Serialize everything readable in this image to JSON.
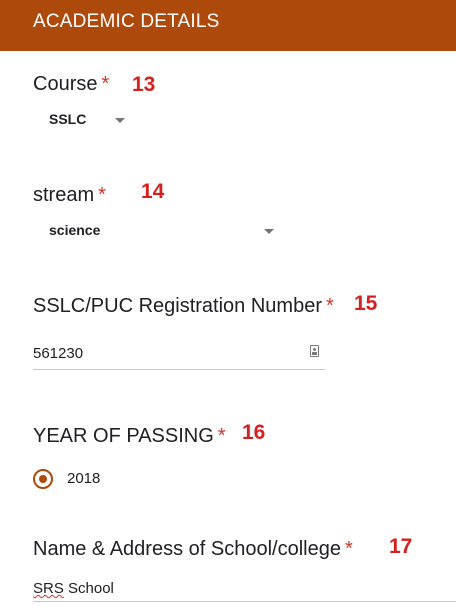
{
  "header": {
    "title": "ACADEMIC DETAILS",
    "background_color": "#ad4a0b"
  },
  "required_marker": "*",
  "questions": {
    "course": {
      "title": "Course",
      "number": "13",
      "selected": "SSLC"
    },
    "stream": {
      "title": "stream",
      "number": "14",
      "selected": "science"
    },
    "registration": {
      "title": "SSLC/PUC Registration Number",
      "number": "15",
      "value": "561230",
      "icon": "contact-card-icon"
    },
    "year": {
      "title": "YEAR OF PASSING",
      "number": "16",
      "options": [
        {
          "label": "2018",
          "selected": true
        }
      ]
    },
    "school": {
      "title": "Name & Address of School/college",
      "number": "17",
      "value_part1": "SRS",
      "value_part2": " School"
    }
  },
  "colors": {
    "accent": "#ad4a0b",
    "required": "#d93025",
    "annotation_number": "#d61f1f"
  }
}
